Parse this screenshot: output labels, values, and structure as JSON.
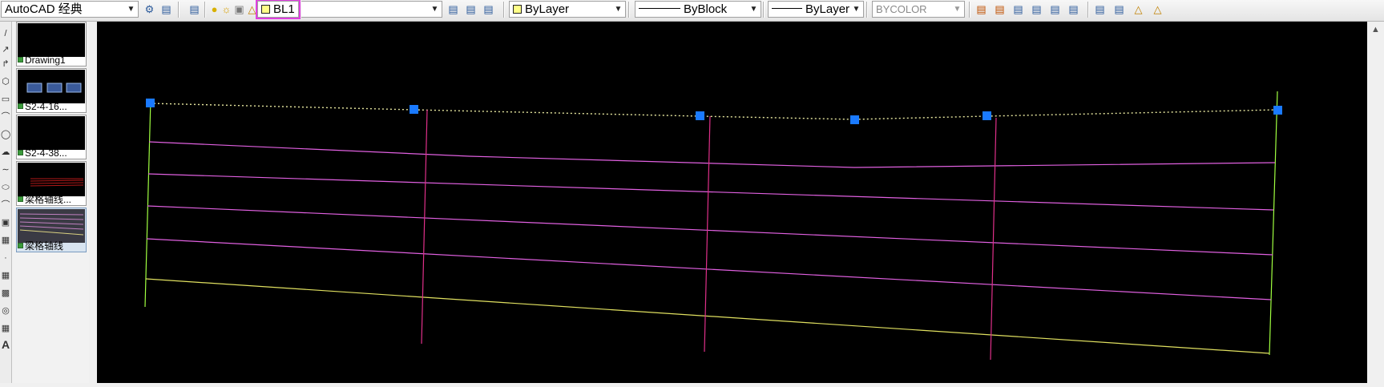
{
  "toolbar": {
    "workspace": "AutoCAD 经典",
    "layer": "BL1",
    "color": "ByLayer",
    "linetype": "ByBlock",
    "lineweight": "ByLayer",
    "plotstyle": "BYCOLOR",
    "layer_swatch_color": "#ffff88"
  },
  "thumbnails": [
    {
      "label": "Drawing1"
    },
    {
      "label": "S2-4-16..."
    },
    {
      "label": "S2-4-38..."
    },
    {
      "label": "梁格轴线..."
    },
    {
      "label": "梁格轴线"
    }
  ],
  "drawing": {
    "background": "#000000",
    "boundary_color": "#a0ff40",
    "axis_color": "#e060e0",
    "bottom_line_color": "#e0e060",
    "grip_color": "#1a7aff",
    "selected_polyline_color": "#e8e8a0"
  }
}
